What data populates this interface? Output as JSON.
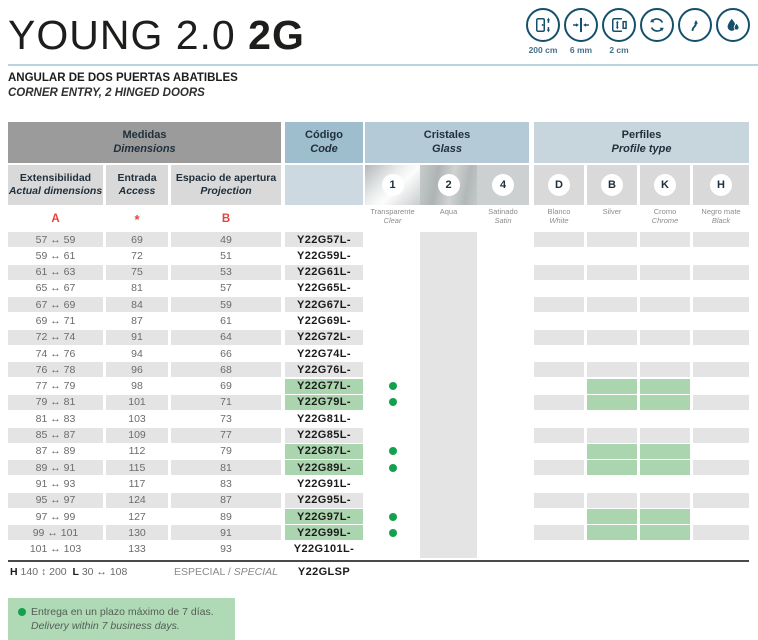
{
  "header": {
    "title_light": "YOUNG 2.0",
    "title_bold": "2G",
    "subtitle_es": "ANGULAR DE DOS PUERTAS ABATIBLES",
    "subtitle_en": "CORNER ENTRY, 2 HINGED DOORS",
    "feature_icons": [
      {
        "name": "door-height-icon",
        "label": "200 cm"
      },
      {
        "name": "glass-thickness-icon",
        "label": "6 mm"
      },
      {
        "name": "extensibility-icon",
        "label": "2 cm"
      },
      {
        "name": "reversible-icon",
        "label": ""
      },
      {
        "name": "opening-direction-icon",
        "label": ""
      },
      {
        "name": "water-repellent-icon",
        "label": ""
      }
    ]
  },
  "table": {
    "groups": {
      "medidas_es": "Medidas",
      "medidas_en": "Dimensions",
      "codigo_es": "Código",
      "codigo_en": "Code",
      "cristales_es": "Cristales",
      "cristales_en": "Glass",
      "perfiles_es": "Perfiles",
      "perfiles_en": "Profile type"
    },
    "columns": {
      "ext_es": "Extensibilidad",
      "ext_en": "Actual dimensions",
      "ext_letter": "A",
      "entrada_es": "Entrada",
      "entrada_en": "Access",
      "entrada_mark": "*",
      "espacio_es": "Espacio de apertura",
      "espacio_en": "Projection",
      "espacio_letter": "B"
    },
    "glass_options": [
      {
        "num": "1",
        "label_es": "Transparente",
        "label_en": "Clear"
      },
      {
        "num": "2",
        "label_es": "Aqua",
        "label_en": ""
      },
      {
        "num": "4",
        "label_es": "Satinado",
        "label_en": "Satin"
      }
    ],
    "profile_options": [
      {
        "letter": "D",
        "label_es": "Blanco",
        "label_en": "White"
      },
      {
        "letter": "B",
        "label_es": "Silver",
        "label_en": ""
      },
      {
        "letter": "K",
        "label_es": "Cromo",
        "label_en": "Chrome"
      },
      {
        "letter": "H",
        "label_es": "Negro mate",
        "label_en": "Black"
      }
    ],
    "rows": [
      {
        "dim": "57 ↔ 59",
        "access": "69",
        "proj": "49",
        "code": "Y22G57L-",
        "fast": false
      },
      {
        "dim": "59 ↔ 61",
        "access": "72",
        "proj": "51",
        "code": "Y22G59L-",
        "fast": false
      },
      {
        "dim": "61 ↔ 63",
        "access": "75",
        "proj": "53",
        "code": "Y22G61L-",
        "fast": false
      },
      {
        "dim": "65 ↔ 67",
        "access": "81",
        "proj": "57",
        "code": "Y22G65L-",
        "fast": false
      },
      {
        "dim": "67 ↔ 69",
        "access": "84",
        "proj": "59",
        "code": "Y22G67L-",
        "fast": false
      },
      {
        "dim": "69 ↔ 71",
        "access": "87",
        "proj": "61",
        "code": "Y22G69L-",
        "fast": false
      },
      {
        "dim": "72 ↔ 74",
        "access": "91",
        "proj": "64",
        "code": "Y22G72L-",
        "fast": false
      },
      {
        "dim": "74 ↔ 76",
        "access": "94",
        "proj": "66",
        "code": "Y22G74L-",
        "fast": false
      },
      {
        "dim": "76 ↔ 78",
        "access": "96",
        "proj": "68",
        "code": "Y22G76L-",
        "fast": false
      },
      {
        "dim": "77 ↔ 79",
        "access": "98",
        "proj": "69",
        "code": "Y22G77L-",
        "fast": true
      },
      {
        "dim": "79 ↔ 81",
        "access": "101",
        "proj": "71",
        "code": "Y22G79L-",
        "fast": true
      },
      {
        "dim": "81 ↔ 83",
        "access": "103",
        "proj": "73",
        "code": "Y22G81L-",
        "fast": false
      },
      {
        "dim": "85 ↔ 87",
        "access": "109",
        "proj": "77",
        "code": "Y22G85L-",
        "fast": false
      },
      {
        "dim": "87 ↔ 89",
        "access": "112",
        "proj": "79",
        "code": "Y22G87L-",
        "fast": true
      },
      {
        "dim": "89 ↔ 91",
        "access": "115",
        "proj": "81",
        "code": "Y22G89L-",
        "fast": true
      },
      {
        "dim": "91 ↔ 93",
        "access": "117",
        "proj": "83",
        "code": "Y22G91L-",
        "fast": false
      },
      {
        "dim": "95 ↔ 97",
        "access": "124",
        "proj": "87",
        "code": "Y22G95L-",
        "fast": false
      },
      {
        "dim": "97 ↔ 99",
        "access": "127",
        "proj": "89",
        "code": "Y22G97L-",
        "fast": true
      },
      {
        "dim": "99 ↔ 101",
        "access": "130",
        "proj": "91",
        "code": "Y22G99L-",
        "fast": true
      },
      {
        "dim": "101 ↔ 103",
        "access": "133",
        "proj": "93",
        "code": "Y22G101L-",
        "fast": false
      }
    ],
    "special_row": {
      "h_label": "H",
      "h_value": "140 ↕ 200",
      "l_label": "L",
      "l_value": "30 ↔ 108",
      "especial_es": "ESPECIAL / ",
      "especial_en": "SPECIAL",
      "code": "Y22GLSP"
    }
  },
  "footnote": {
    "line_es": "Entrega en un plazo máximo de 7 días.",
    "line_en": "Delivery within 7 business days."
  },
  "colors": {
    "accent_teal": "#15506b",
    "header_gray": "#9b9b9b",
    "header_blue_code": "#9fbecd",
    "header_blue_glass": "#b4cad7",
    "header_blue_profile": "#c7d5dd",
    "row_stripe": "#e4e4e4",
    "fast_green_cell": "#abd5ae",
    "fast_green_dot": "#13a04f",
    "red_marker": "#e8413c",
    "footnote_bg": "#b0d9b5"
  }
}
